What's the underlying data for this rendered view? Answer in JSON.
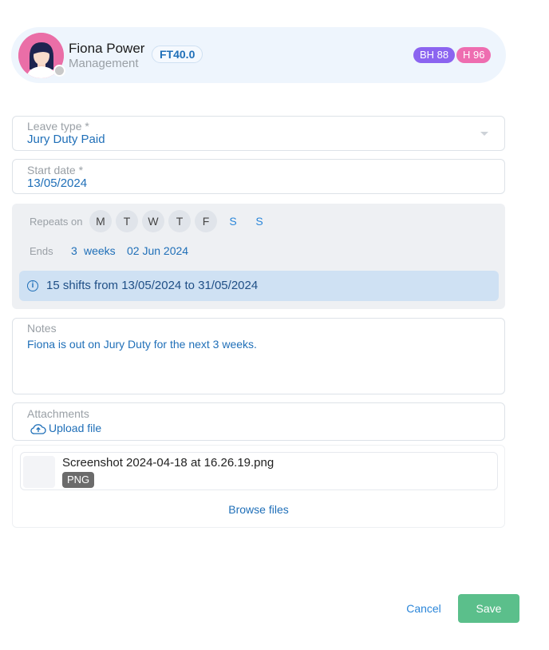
{
  "employee": {
    "name": "Fiona Power",
    "department": "Management",
    "contract": "FT40.0",
    "avatar_icon": "avatar-illustration",
    "presence_status_color": "#c9c9c9",
    "balances": [
      {
        "label": "BH 88",
        "color": "#8b64f0"
      },
      {
        "label": "H 96",
        "color": "#ee6db0"
      }
    ]
  },
  "leave_type": {
    "label": "Leave type *",
    "value": "Jury Duty Paid",
    "icon": "chevron-down-icon"
  },
  "start_date": {
    "label": "Start date *",
    "value": "13/05/2024"
  },
  "repeats": {
    "label": "Repeats on",
    "days": [
      {
        "label": "M",
        "selected": true
      },
      {
        "label": "T",
        "selected": true
      },
      {
        "label": "W",
        "selected": true
      },
      {
        "label": "T",
        "selected": true
      },
      {
        "label": "F",
        "selected": true
      },
      {
        "label": "S",
        "selected": false
      },
      {
        "label": "S",
        "selected": false
      }
    ],
    "ends_label": "Ends",
    "ends_count": "3",
    "ends_unit": "weeks",
    "ends_date": "02 Jun 2024",
    "summary": "15 shifts from 13/05/2024 to 31/05/2024",
    "summary_icon": "info-icon"
  },
  "notes": {
    "label": "Notes",
    "value": "Fiona is out on Jury Duty for the next 3 weeks."
  },
  "attachments": {
    "label": "Attachments",
    "upload_label": "Upload file",
    "upload_icon": "cloud-upload-icon",
    "files": [
      {
        "name": "Screenshot 2024-04-18 at 16.26.19.png",
        "type": "PNG"
      }
    ],
    "browse_label": "Browse files"
  },
  "actions": {
    "cancel": "Cancel",
    "save": "Save"
  },
  "colors": {
    "accent": "#1f6fb8",
    "save": "#5bbf8b",
    "header_bg": "#eef5fd"
  }
}
